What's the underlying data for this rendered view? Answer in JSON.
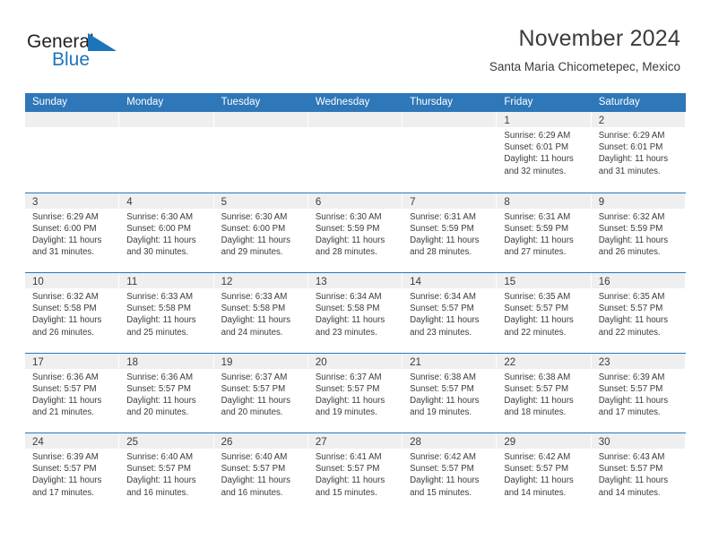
{
  "brand": {
    "name_part1": "General",
    "name_part2": "Blue",
    "triangle_icon": "brand-triangle-icon",
    "accent_color": "#1b75bb"
  },
  "header": {
    "title": "November 2024",
    "subtitle": "Santa Maria Chicometepec, Mexico"
  },
  "colors": {
    "header_blue": "#2e77b8",
    "date_band_gray": "#efeff0",
    "text": "#3b3b3b"
  },
  "weekdays": [
    "Sunday",
    "Monday",
    "Tuesday",
    "Wednesday",
    "Thursday",
    "Friday",
    "Saturday"
  ],
  "labels": {
    "sunrise": "Sunrise:",
    "sunset": "Sunset:",
    "daylight": "Daylight:"
  },
  "weeks": [
    [
      {
        "date": "",
        "sunrise": "",
        "sunset": "",
        "daylight_1": "",
        "daylight_2": ""
      },
      {
        "date": "",
        "sunrise": "",
        "sunset": "",
        "daylight_1": "",
        "daylight_2": ""
      },
      {
        "date": "",
        "sunrise": "",
        "sunset": "",
        "daylight_1": "",
        "daylight_2": ""
      },
      {
        "date": "",
        "sunrise": "",
        "sunset": "",
        "daylight_1": "",
        "daylight_2": ""
      },
      {
        "date": "",
        "sunrise": "",
        "sunset": "",
        "daylight_1": "",
        "daylight_2": ""
      },
      {
        "date": "1",
        "sunrise": "Sunrise: 6:29 AM",
        "sunset": "Sunset: 6:01 PM",
        "daylight_1": "Daylight: 11 hours",
        "daylight_2": "and 32 minutes."
      },
      {
        "date": "2",
        "sunrise": "Sunrise: 6:29 AM",
        "sunset": "Sunset: 6:01 PM",
        "daylight_1": "Daylight: 11 hours",
        "daylight_2": "and 31 minutes."
      }
    ],
    [
      {
        "date": "3",
        "sunrise": "Sunrise: 6:29 AM",
        "sunset": "Sunset: 6:00 PM",
        "daylight_1": "Daylight: 11 hours",
        "daylight_2": "and 31 minutes."
      },
      {
        "date": "4",
        "sunrise": "Sunrise: 6:30 AM",
        "sunset": "Sunset: 6:00 PM",
        "daylight_1": "Daylight: 11 hours",
        "daylight_2": "and 30 minutes."
      },
      {
        "date": "5",
        "sunrise": "Sunrise: 6:30 AM",
        "sunset": "Sunset: 6:00 PM",
        "daylight_1": "Daylight: 11 hours",
        "daylight_2": "and 29 minutes."
      },
      {
        "date": "6",
        "sunrise": "Sunrise: 6:30 AM",
        "sunset": "Sunset: 5:59 PM",
        "daylight_1": "Daylight: 11 hours",
        "daylight_2": "and 28 minutes."
      },
      {
        "date": "7",
        "sunrise": "Sunrise: 6:31 AM",
        "sunset": "Sunset: 5:59 PM",
        "daylight_1": "Daylight: 11 hours",
        "daylight_2": "and 28 minutes."
      },
      {
        "date": "8",
        "sunrise": "Sunrise: 6:31 AM",
        "sunset": "Sunset: 5:59 PM",
        "daylight_1": "Daylight: 11 hours",
        "daylight_2": "and 27 minutes."
      },
      {
        "date": "9",
        "sunrise": "Sunrise: 6:32 AM",
        "sunset": "Sunset: 5:59 PM",
        "daylight_1": "Daylight: 11 hours",
        "daylight_2": "and 26 minutes."
      }
    ],
    [
      {
        "date": "10",
        "sunrise": "Sunrise: 6:32 AM",
        "sunset": "Sunset: 5:58 PM",
        "daylight_1": "Daylight: 11 hours",
        "daylight_2": "and 26 minutes."
      },
      {
        "date": "11",
        "sunrise": "Sunrise: 6:33 AM",
        "sunset": "Sunset: 5:58 PM",
        "daylight_1": "Daylight: 11 hours",
        "daylight_2": "and 25 minutes."
      },
      {
        "date": "12",
        "sunrise": "Sunrise: 6:33 AM",
        "sunset": "Sunset: 5:58 PM",
        "daylight_1": "Daylight: 11 hours",
        "daylight_2": "and 24 minutes."
      },
      {
        "date": "13",
        "sunrise": "Sunrise: 6:34 AM",
        "sunset": "Sunset: 5:58 PM",
        "daylight_1": "Daylight: 11 hours",
        "daylight_2": "and 23 minutes."
      },
      {
        "date": "14",
        "sunrise": "Sunrise: 6:34 AM",
        "sunset": "Sunset: 5:57 PM",
        "daylight_1": "Daylight: 11 hours",
        "daylight_2": "and 23 minutes."
      },
      {
        "date": "15",
        "sunrise": "Sunrise: 6:35 AM",
        "sunset": "Sunset: 5:57 PM",
        "daylight_1": "Daylight: 11 hours",
        "daylight_2": "and 22 minutes."
      },
      {
        "date": "16",
        "sunrise": "Sunrise: 6:35 AM",
        "sunset": "Sunset: 5:57 PM",
        "daylight_1": "Daylight: 11 hours",
        "daylight_2": "and 22 minutes."
      }
    ],
    [
      {
        "date": "17",
        "sunrise": "Sunrise: 6:36 AM",
        "sunset": "Sunset: 5:57 PM",
        "daylight_1": "Daylight: 11 hours",
        "daylight_2": "and 21 minutes."
      },
      {
        "date": "18",
        "sunrise": "Sunrise: 6:36 AM",
        "sunset": "Sunset: 5:57 PM",
        "daylight_1": "Daylight: 11 hours",
        "daylight_2": "and 20 minutes."
      },
      {
        "date": "19",
        "sunrise": "Sunrise: 6:37 AM",
        "sunset": "Sunset: 5:57 PM",
        "daylight_1": "Daylight: 11 hours",
        "daylight_2": "and 20 minutes."
      },
      {
        "date": "20",
        "sunrise": "Sunrise: 6:37 AM",
        "sunset": "Sunset: 5:57 PM",
        "daylight_1": "Daylight: 11 hours",
        "daylight_2": "and 19 minutes."
      },
      {
        "date": "21",
        "sunrise": "Sunrise: 6:38 AM",
        "sunset": "Sunset: 5:57 PM",
        "daylight_1": "Daylight: 11 hours",
        "daylight_2": "and 19 minutes."
      },
      {
        "date": "22",
        "sunrise": "Sunrise: 6:38 AM",
        "sunset": "Sunset: 5:57 PM",
        "daylight_1": "Daylight: 11 hours",
        "daylight_2": "and 18 minutes."
      },
      {
        "date": "23",
        "sunrise": "Sunrise: 6:39 AM",
        "sunset": "Sunset: 5:57 PM",
        "daylight_1": "Daylight: 11 hours",
        "daylight_2": "and 17 minutes."
      }
    ],
    [
      {
        "date": "24",
        "sunrise": "Sunrise: 6:39 AM",
        "sunset": "Sunset: 5:57 PM",
        "daylight_1": "Daylight: 11 hours",
        "daylight_2": "and 17 minutes."
      },
      {
        "date": "25",
        "sunrise": "Sunrise: 6:40 AM",
        "sunset": "Sunset: 5:57 PM",
        "daylight_1": "Daylight: 11 hours",
        "daylight_2": "and 16 minutes."
      },
      {
        "date": "26",
        "sunrise": "Sunrise: 6:40 AM",
        "sunset": "Sunset: 5:57 PM",
        "daylight_1": "Daylight: 11 hours",
        "daylight_2": "and 16 minutes."
      },
      {
        "date": "27",
        "sunrise": "Sunrise: 6:41 AM",
        "sunset": "Sunset: 5:57 PM",
        "daylight_1": "Daylight: 11 hours",
        "daylight_2": "and 15 minutes."
      },
      {
        "date": "28",
        "sunrise": "Sunrise: 6:42 AM",
        "sunset": "Sunset: 5:57 PM",
        "daylight_1": "Daylight: 11 hours",
        "daylight_2": "and 15 minutes."
      },
      {
        "date": "29",
        "sunrise": "Sunrise: 6:42 AM",
        "sunset": "Sunset: 5:57 PM",
        "daylight_1": "Daylight: 11 hours",
        "daylight_2": "and 14 minutes."
      },
      {
        "date": "30",
        "sunrise": "Sunrise: 6:43 AM",
        "sunset": "Sunset: 5:57 PM",
        "daylight_1": "Daylight: 11 hours",
        "daylight_2": "and 14 minutes."
      }
    ]
  ]
}
